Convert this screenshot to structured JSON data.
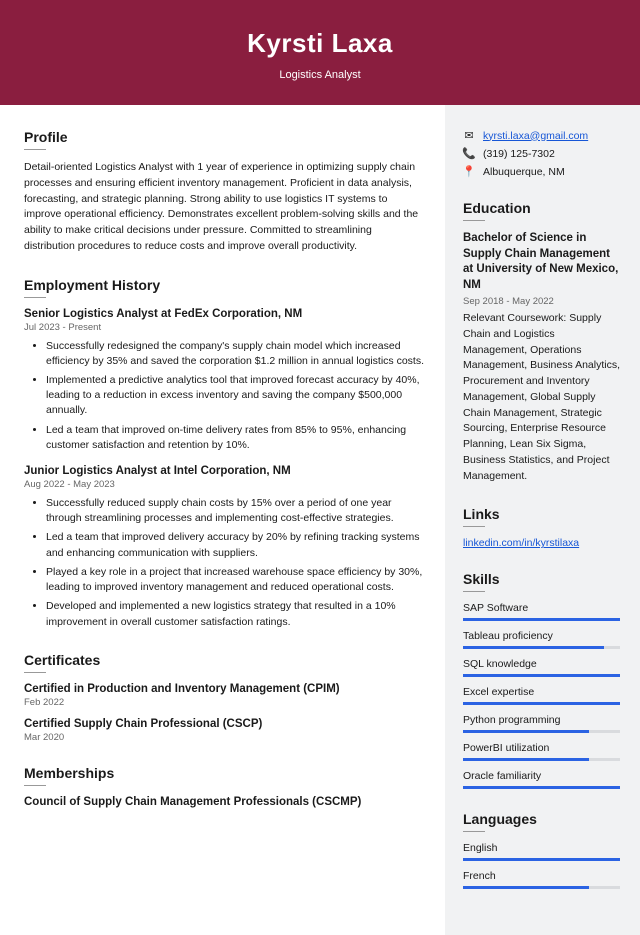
{
  "header": {
    "name": "Kyrsti Laxa",
    "title": "Logistics Analyst"
  },
  "profile": {
    "heading": "Profile",
    "text": "Detail-oriented Logistics Analyst with 1 year of experience in optimizing supply chain processes and ensuring efficient inventory management. Proficient in data analysis, forecasting, and strategic planning. Strong ability to use logistics IT systems to improve operational efficiency. Demonstrates excellent problem-solving skills and the ability to make critical decisions under pressure. Committed to streamlining distribution procedures to reduce costs and improve overall productivity."
  },
  "employment": {
    "heading": "Employment History",
    "jobs": [
      {
        "title": "Senior Logistics Analyst at FedEx Corporation, NM",
        "date": "Jul 2023 - Present",
        "bullets": [
          "Successfully redesigned the company's supply chain model which increased efficiency by 35% and saved the corporation $1.2 million in annual logistics costs.",
          "Implemented a predictive analytics tool that improved forecast accuracy by 40%, leading to a reduction in excess inventory and saving the company $500,000 annually.",
          "Led a team that improved on-time delivery rates from 85% to 95%, enhancing customer satisfaction and retention by 10%."
        ]
      },
      {
        "title": "Junior Logistics Analyst at Intel Corporation, NM",
        "date": "Aug 2022 - May 2023",
        "bullets": [
          "Successfully reduced supply chain costs by 15% over a period of one year through streamlining processes and implementing cost-effective strategies.",
          "Led a team that improved delivery accuracy by 20% by refining tracking systems and enhancing communication with suppliers.",
          "Played a key role in a project that increased warehouse space efficiency by 30%, leading to improved inventory management and reduced operational costs.",
          "Developed and implemented a new logistics strategy that resulted in a 10% improvement in overall customer satisfaction ratings."
        ]
      }
    ]
  },
  "certificates": {
    "heading": "Certificates",
    "items": [
      {
        "title": "Certified in Production and Inventory Management (CPIM)",
        "date": "Feb 2022"
      },
      {
        "title": "Certified Supply Chain Professional (CSCP)",
        "date": "Mar 2020"
      }
    ]
  },
  "memberships": {
    "heading": "Memberships",
    "items": [
      {
        "title": "Council of Supply Chain Management Professionals (CSCMP)"
      }
    ]
  },
  "contact": {
    "email": "kyrsti.laxa@gmail.com",
    "phone": "(319) 125-7302",
    "location": "Albuquerque, NM"
  },
  "education": {
    "heading": "Education",
    "degree": "Bachelor of Science in Supply Chain Management at University of New Mexico, NM",
    "date": "Sep 2018 - May 2022",
    "text": "Relevant Coursework: Supply Chain and Logistics Management, Operations Management, Business Analytics, Procurement and Inventory Management, Global Supply Chain Management, Strategic Sourcing, Enterprise Resource Planning, Lean Six Sigma, Business Statistics, and Project Management."
  },
  "links": {
    "heading": "Links",
    "items": [
      {
        "text": "linkedin.com/in/kyrstilaxa"
      }
    ]
  },
  "skills": {
    "heading": "Skills",
    "items": [
      {
        "name": "SAP Software",
        "level": 100
      },
      {
        "name": "Tableau proficiency",
        "level": 90
      },
      {
        "name": "SQL knowledge",
        "level": 100
      },
      {
        "name": "Excel expertise",
        "level": 100
      },
      {
        "name": "Python programming",
        "level": 80
      },
      {
        "name": "PowerBI utilization",
        "level": 80
      },
      {
        "name": "Oracle familiarity",
        "level": 100
      }
    ]
  },
  "languages": {
    "heading": "Languages",
    "items": [
      {
        "name": "English",
        "level": 100
      },
      {
        "name": "French",
        "level": 80
      }
    ]
  }
}
